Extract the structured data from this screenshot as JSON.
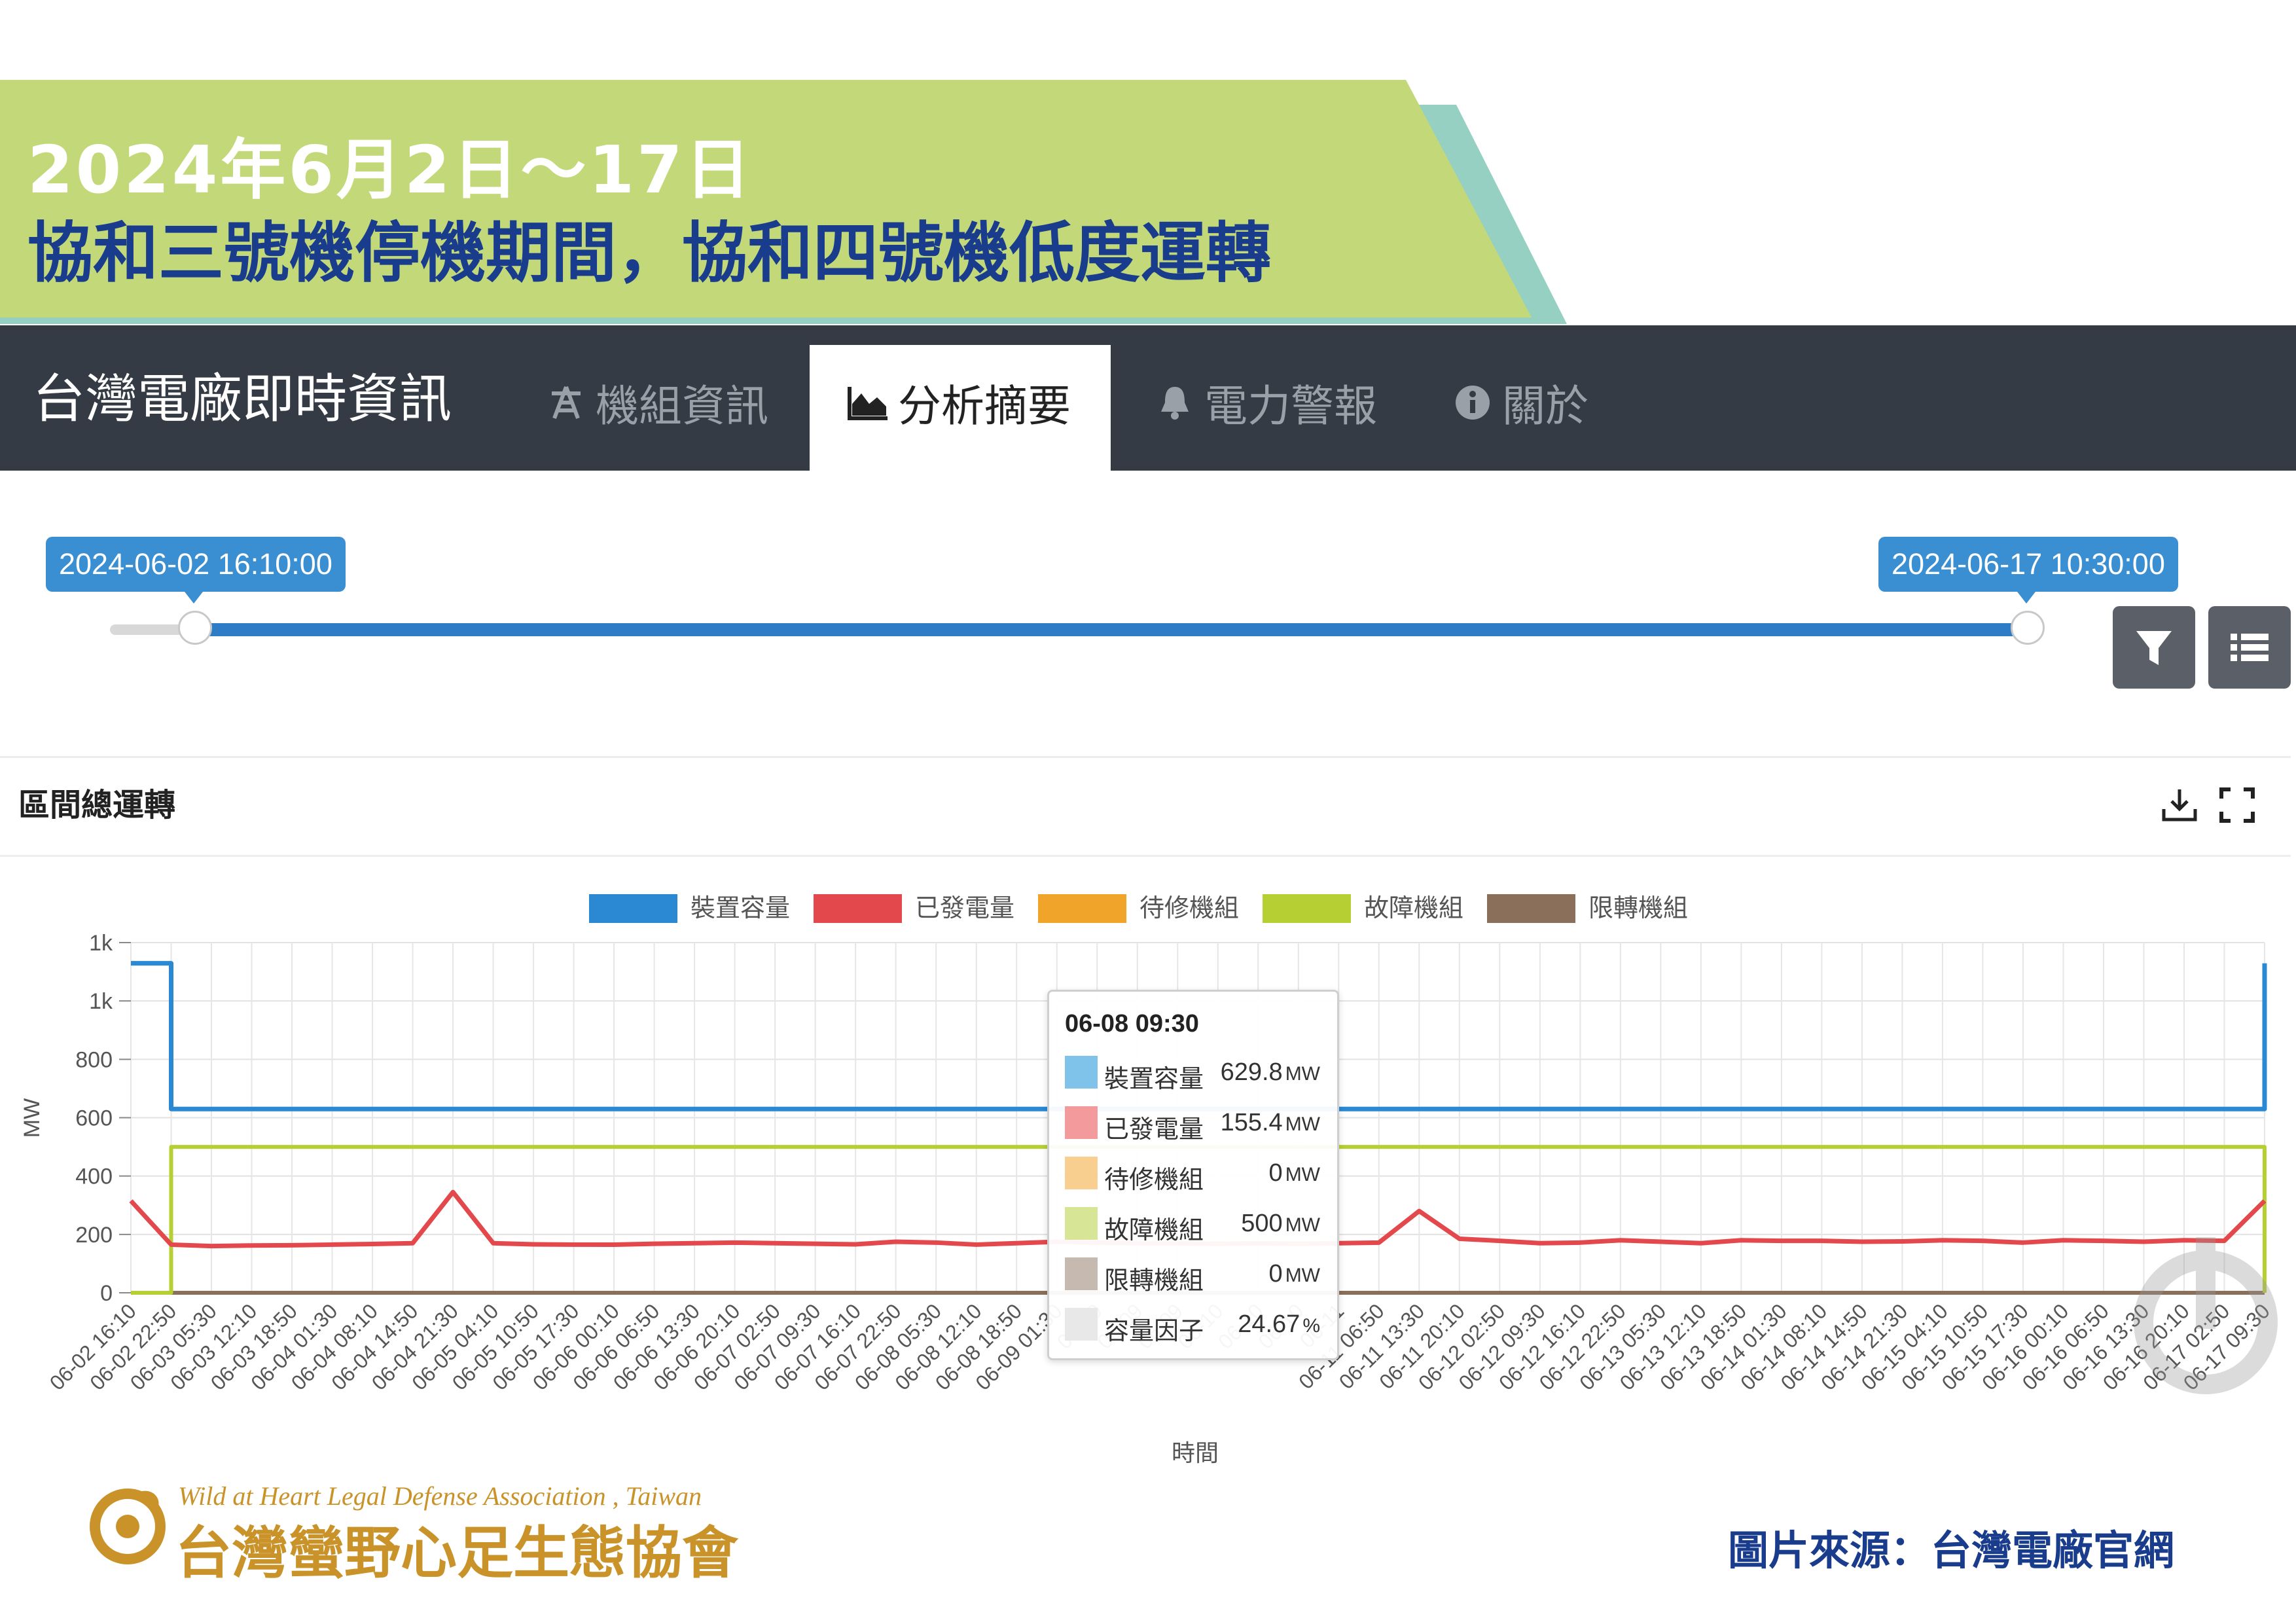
{
  "banner": {
    "line1": "2024年6月2日～17日",
    "line2": "協和三號機停機期間，協和四號機低度運轉",
    "colors": {
      "green": "#c3d979",
      "teal": "#95d0c3",
      "title_blue": "#1a3c8c"
    }
  },
  "navbar": {
    "brand": "台灣電廠即時資訊",
    "tabs": [
      {
        "label": "機組資訊",
        "icon": "tower-icon"
      },
      {
        "label": "分析摘要",
        "icon": "area-chart-icon",
        "active": true
      },
      {
        "label": "電力警報",
        "icon": "bell-icon"
      },
      {
        "label": "關於",
        "icon": "info-icon"
      }
    ]
  },
  "slider": {
    "start": "2024-06-02 16:10:00",
    "end": "2024-06-17 10:30:00"
  },
  "panel": {
    "title": "區間總運轉"
  },
  "chart_data": {
    "type": "line",
    "ylabel": "MW",
    "xlabel": "時間",
    "y_tick_labels": [
      "0",
      "200",
      "400",
      "600",
      "800",
      "1k",
      "1k"
    ],
    "y_tick_values": [
      0,
      200,
      400,
      600,
      800,
      1000,
      1200
    ],
    "ylim": [
      0,
      1200
    ],
    "grid": true,
    "legend_position": "top-center",
    "categories": [
      "06-02 16:10",
      "06-02 22:50",
      "06-03 05:30",
      "06-03 12:10",
      "06-03 18:50",
      "06-04 01:30",
      "06-04 08:10",
      "06-04 14:50",
      "06-04 21:30",
      "06-05 04:10",
      "06-05 10:50",
      "06-05 17:30",
      "06-06 00:10",
      "06-06 06:50",
      "06-06 13:30",
      "06-06 20:10",
      "06-07 02:50",
      "06-07 09:30",
      "06-07 16:10",
      "06-07 22:50",
      "06-08 05:30",
      "06-08 12:10",
      "06-08 18:50",
      "06-09 01:30",
      "06-09 08:10",
      "06-09 14:50",
      "06-09 21:30",
      "06-10 04:10",
      "06-10 10:50",
      "06-10 17:30",
      "06-11 00:10",
      "06-11 06:50",
      "06-11 13:30",
      "06-11 20:10",
      "06-12 02:50",
      "06-12 09:30",
      "06-12 16:10",
      "06-12 22:50",
      "06-13 05:30",
      "06-13 12:10",
      "06-13 18:50",
      "06-14 01:30",
      "06-14 08:10",
      "06-14 14:50",
      "06-14 21:30",
      "06-15 04:10",
      "06-15 10:50",
      "06-15 17:30",
      "06-16 00:10",
      "06-16 06:50",
      "06-16 13:30",
      "06-16 20:10",
      "06-17 02:50",
      "06-17 09:30"
    ],
    "x_tick_labels_shown": [
      "06-02 16:10",
      "06-02 22:50",
      "06-03 05:30",
      "06-03 12:10",
      "06-03 18:50",
      "06-04 01:30",
      "06-04 08:10",
      "06-04 14:50",
      "06-04 21:30",
      "06-05 04:10",
      "06-05 10:50",
      "06-05 17:30",
      "06-06 00:10",
      "06-06 06:50",
      "06-06 13:30",
      "06-06 20:10",
      "06-07 02:50",
      "06-07 09:30",
      "06-07 16:10",
      "06-07 22:50",
      "06-08 05:30",
      "06-08 12:10",
      "06-08 18:50",
      "06-09 01:30",
      "06-09",
      "06-09",
      "06-09",
      "06-10",
      "06-10",
      "06-10",
      "06-11",
      "06-11 06:50",
      "06-11 13:30",
      "06-11 20:10",
      "06-12 02:50",
      "06-12 09:30",
      "06-12 16:10",
      "06-12 22:50",
      "06-13 05:30",
      "06-13 12:10",
      "06-13 18:50",
      "06-14 01:30",
      "06-14 08:10",
      "06-14 14:50",
      "06-14 21:30",
      "06-15 04:10",
      "06-15 10:50",
      "06-15 17:30",
      "06-16 00:10",
      "06-16 06:50",
      "06-16 13:30",
      "06-16 20:10",
      "06-17 02:50",
      "06-17 09:30"
    ],
    "series": [
      {
        "name": "裝置容量",
        "color": "#2b88d3",
        "values": [
          1129,
          629.8,
          629.8,
          629.8,
          629.8,
          629.8,
          629.8,
          629.8,
          629.8,
          629.8,
          629.8,
          629.8,
          629.8,
          629.8,
          629.8,
          629.8,
          629.8,
          629.8,
          629.8,
          629.8,
          629.8,
          629.8,
          629.8,
          629.8,
          629.8,
          629.8,
          629.8,
          629.8,
          629.8,
          629.8,
          629.8,
          629.8,
          629.8,
          629.8,
          629.8,
          629.8,
          629.8,
          629.8,
          629.8,
          629.8,
          629.8,
          629.8,
          629.8,
          629.8,
          629.8,
          629.8,
          629.8,
          629.8,
          629.8,
          629.8,
          629.8,
          629.8,
          629.8,
          1129
        ]
      },
      {
        "name": "已發電量",
        "color": "#e3484c",
        "values": [
          315,
          165,
          160,
          162,
          163,
          165,
          167,
          170,
          345,
          170,
          166,
          165,
          165,
          168,
          170,
          172,
          170,
          168,
          166,
          175,
          172,
          165,
          170,
          175,
          172,
          170,
          170,
          168,
          170,
          168,
          170,
          172,
          280,
          185,
          178,
          170,
          172,
          180,
          175,
          170,
          180,
          178,
          178,
          175,
          176,
          180,
          178,
          172,
          180,
          178,
          175,
          180,
          178,
          315
        ]
      },
      {
        "name": "待修機組",
        "color": "#f0a429",
        "values": [
          0,
          0,
          0,
          0,
          0,
          0,
          0,
          0,
          0,
          0,
          0,
          0,
          0,
          0,
          0,
          0,
          0,
          0,
          0,
          0,
          0,
          0,
          0,
          0,
          0,
          0,
          0,
          0,
          0,
          0,
          0,
          0,
          0,
          0,
          0,
          0,
          0,
          0,
          0,
          0,
          0,
          0,
          0,
          0,
          0,
          0,
          0,
          0,
          0,
          0,
          0,
          0,
          0,
          0
        ]
      },
      {
        "name": "故障機組",
        "color": "#b6cf33",
        "values": [
          0,
          500,
          500,
          500,
          500,
          500,
          500,
          500,
          500,
          500,
          500,
          500,
          500,
          500,
          500,
          500,
          500,
          500,
          500,
          500,
          500,
          500,
          500,
          500,
          500,
          500,
          500,
          500,
          500,
          500,
          500,
          500,
          500,
          500,
          500,
          500,
          500,
          500,
          500,
          500,
          500,
          500,
          500,
          500,
          500,
          500,
          500,
          500,
          500,
          500,
          500,
          500,
          500,
          0
        ]
      },
      {
        "name": "限轉機組",
        "color": "#8a6f5a",
        "values": [
          0,
          0,
          0,
          0,
          0,
          0,
          0,
          0,
          0,
          0,
          0,
          0,
          0,
          0,
          0,
          0,
          0,
          0,
          0,
          0,
          0,
          0,
          0,
          0,
          0,
          0,
          0,
          0,
          0,
          0,
          0,
          0,
          0,
          0,
          0,
          0,
          0,
          0,
          0,
          0,
          0,
          0,
          0,
          0,
          0,
          0,
          0,
          0,
          0,
          0,
          0,
          0,
          0,
          0
        ]
      }
    ],
    "tooltip": {
      "title": "06-08 09:30",
      "rows": [
        {
          "name": "裝置容量",
          "value": "629.8",
          "unit": "MW",
          "color": "#7fc3ea"
        },
        {
          "name": "已發電量",
          "value": "155.4",
          "unit": "MW",
          "color": "#f29a9c"
        },
        {
          "name": "待修機組",
          "value": "0",
          "unit": "MW",
          "color": "#f8cf8e"
        },
        {
          "name": "故障機組",
          "value": "500",
          "unit": "MW",
          "color": "#d6e596"
        },
        {
          "name": "限轉機組",
          "value": "0",
          "unit": "MW",
          "color": "#c5b9b0"
        },
        {
          "name": "容量因子",
          "value": "24.67",
          "unit": "%",
          "color": "#e8e8e8"
        }
      ]
    }
  },
  "footer": {
    "org_en": "Wild at Heart Legal Defense Association , Taiwan",
    "org_zh": "台灣蠻野心足生態協會",
    "source": "圖片來源：台灣電廠官網"
  }
}
